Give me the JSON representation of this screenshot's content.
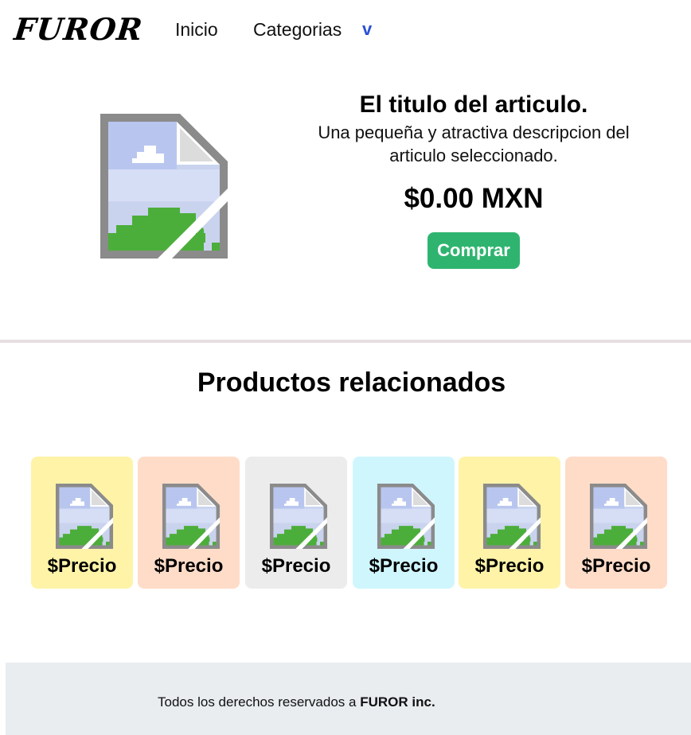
{
  "nav": {
    "logo": "FUROR",
    "links": [
      {
        "label": "Inicio"
      },
      {
        "label": "Categorias"
      }
    ],
    "dropdown_indicator": "v",
    "accent_color": "#2b4fd6"
  },
  "product": {
    "image_icon": "broken-image-icon",
    "title": "El titulo del articulo.",
    "description": "Una pequeña y atractiva descripcion del articulo seleccionado.",
    "price": "$0.00 MXN",
    "buy_label": "Comprar",
    "buy_color": "#2fb470"
  },
  "related": {
    "title": "Productos relacionados",
    "cards": [
      {
        "price": "$Precio",
        "bg": "#fff3a8"
      },
      {
        "price": "$Precio",
        "bg": "#ffdcc8"
      },
      {
        "price": "$Precio",
        "bg": "#ececec"
      },
      {
        "price": "$Precio",
        "bg": "#d0f6fd"
      },
      {
        "price": "$Precio",
        "bg": "#fff3a8"
      },
      {
        "price": "$Precio",
        "bg": "#ffdcc8"
      }
    ]
  },
  "footer": {
    "text": "Todos los derechos reservados a",
    "brand": "FUROR inc."
  }
}
